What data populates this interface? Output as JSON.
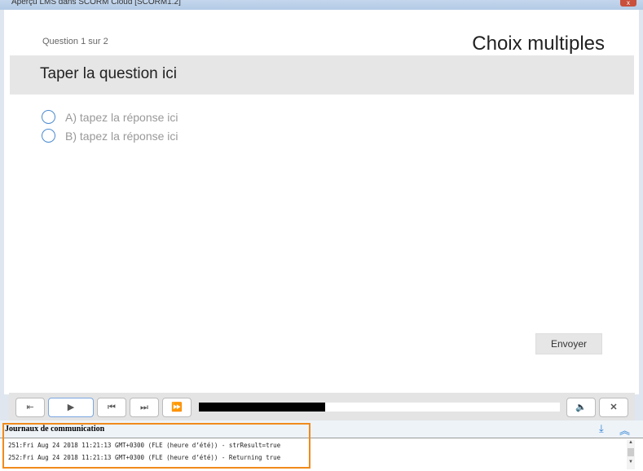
{
  "window": {
    "title": "Aperçu LMS dans SCORM Cloud [SCORM1.2]",
    "close": "x"
  },
  "question": {
    "counter": "Question 1 sur 2",
    "type": "Choix multiples",
    "text": "Taper la question ici",
    "options": [
      "A) tapez la réponse ici",
      "B) tapez la réponse ici"
    ],
    "submit": "Envoyer"
  },
  "player": {
    "exit": "⇤",
    "play": "▶",
    "prev": "⏮",
    "next": "⏭",
    "ff": "⏩",
    "volume": "🔈",
    "close": "✕",
    "progress_percent": 35
  },
  "log": {
    "title": "Journaux de communication",
    "download": "⤓",
    "collapse": "︽",
    "lines": [
      "251:Fri Aug 24 2018 11:21:13 GMT+0300 (FLE (heure d’été)) - strResult=true",
      "252:Fri Aug 24 2018 11:21:13 GMT+0300 (FLE (heure d’été)) - Returning true"
    ]
  }
}
